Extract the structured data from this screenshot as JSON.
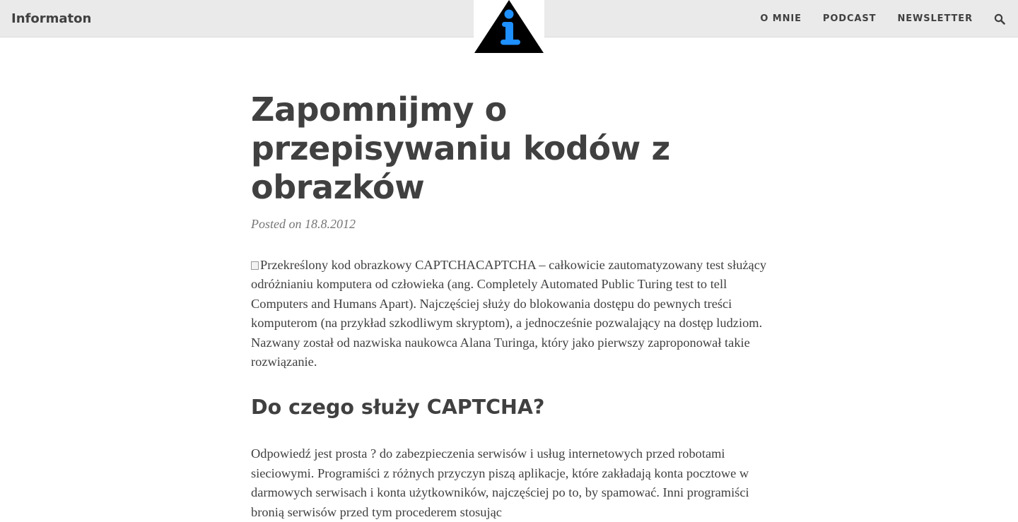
{
  "site": {
    "brand": "Informaton",
    "logo_alt": "i"
  },
  "nav": {
    "items": [
      "O MNIE",
      "PODCAST",
      "NEWSLETTER"
    ],
    "search_icon": "search-icon"
  },
  "article": {
    "title": "Zapomnijmy o przepisywaniu kodów z obrazków",
    "posted_prefix": "Posted on",
    "date": "18.8.2012",
    "image_alt": "Przekreślony kod obrazkowy CAPTCHA",
    "lead_text": "CAPTCHA – całkowicie zautomatyzowany test służący odróżnianiu komputera od człowieka (ang. Completely Automated Public Turing test to tell Computers and Humans Apart). Najczęściej służy do blokowania dostępu do pewnych treści komputerom (na przykład szkodliwym skryptom), a jednocześnie pozwalający na dostęp ludziom. Nazwany został od nazwiska naukowca Alana Turinga, który jako pierwszy zaproponował takie rozwiązanie.",
    "section_heading": "Do czego służy CAPTCHA?",
    "section_text": "Odpowiedź jest prosta ? do zabezpieczenia serwisów i usług internetowych przed robotami sieciowymi. Programiści z różnych przyczyn piszą aplikacje, które zakładają konta pocztowe w darmowych serwisach i konta użytkowników, najczęściej po to, by spamować. Inni programiści bronią serwisów przed tym procederem stosując"
  },
  "colors": {
    "topbar_bg": "#eaeaea",
    "text": "#404040",
    "meta": "#767676",
    "logo_triangle": "#000000",
    "logo_i": "#1e90ff"
  }
}
